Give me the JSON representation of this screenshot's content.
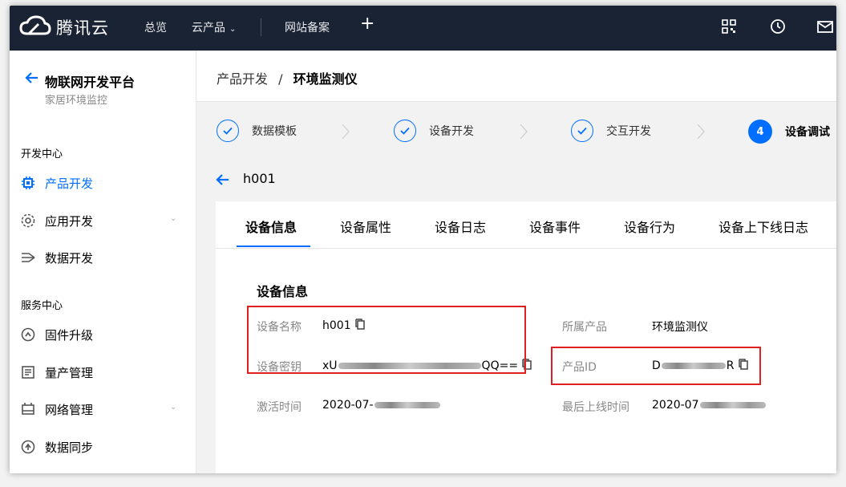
{
  "topbar": {
    "brand": "腾讯云",
    "nav": {
      "overview": "总览",
      "products": "云产品",
      "beian": "网站备案"
    }
  },
  "sidebar": {
    "title": "物联网开发平台",
    "subtitle": "家居环境监控",
    "dev_center": "开发中心",
    "service_center": "服务中心",
    "items": {
      "product_dev": "产品开发",
      "app_dev": "应用开发",
      "data_dev": "数据开发",
      "firmware": "固件升级",
      "mass_prod": "量产管理",
      "network": "网络管理",
      "data_sync": "数据同步"
    }
  },
  "breadcrumb": {
    "parent": "产品开发",
    "sep": "/",
    "current": "环境监测仪"
  },
  "steps": [
    {
      "label": "数据模板",
      "state": "done"
    },
    {
      "label": "设备开发",
      "state": "done"
    },
    {
      "label": "交互开发",
      "state": "done"
    },
    {
      "label": "设备调试",
      "state": "current",
      "number": "4"
    }
  ],
  "device": {
    "name": "h001"
  },
  "tabs": [
    "设备信息",
    "设备属性",
    "设备日志",
    "设备事件",
    "设备行为",
    "设备上下线日志"
  ],
  "info": {
    "heading": "设备信息",
    "device_name_label": "设备名称",
    "device_name_value": "h001",
    "device_secret_label": "设备密钥",
    "device_secret_prefix": "xU",
    "device_secret_suffix": "QQ==",
    "activated_label": "激活时间",
    "activated_prefix": "2020-07-",
    "product_label": "所属产品",
    "product_value": "环境监测仪",
    "product_id_label": "产品ID",
    "product_id_prefix": "D",
    "product_id_suffix": "R",
    "last_online_label": "最后上线时间",
    "last_online_prefix": "2020-07"
  },
  "colors": {
    "topbar": "#1a2333",
    "accent": "#006eff",
    "highlight_box": "#e02020"
  }
}
